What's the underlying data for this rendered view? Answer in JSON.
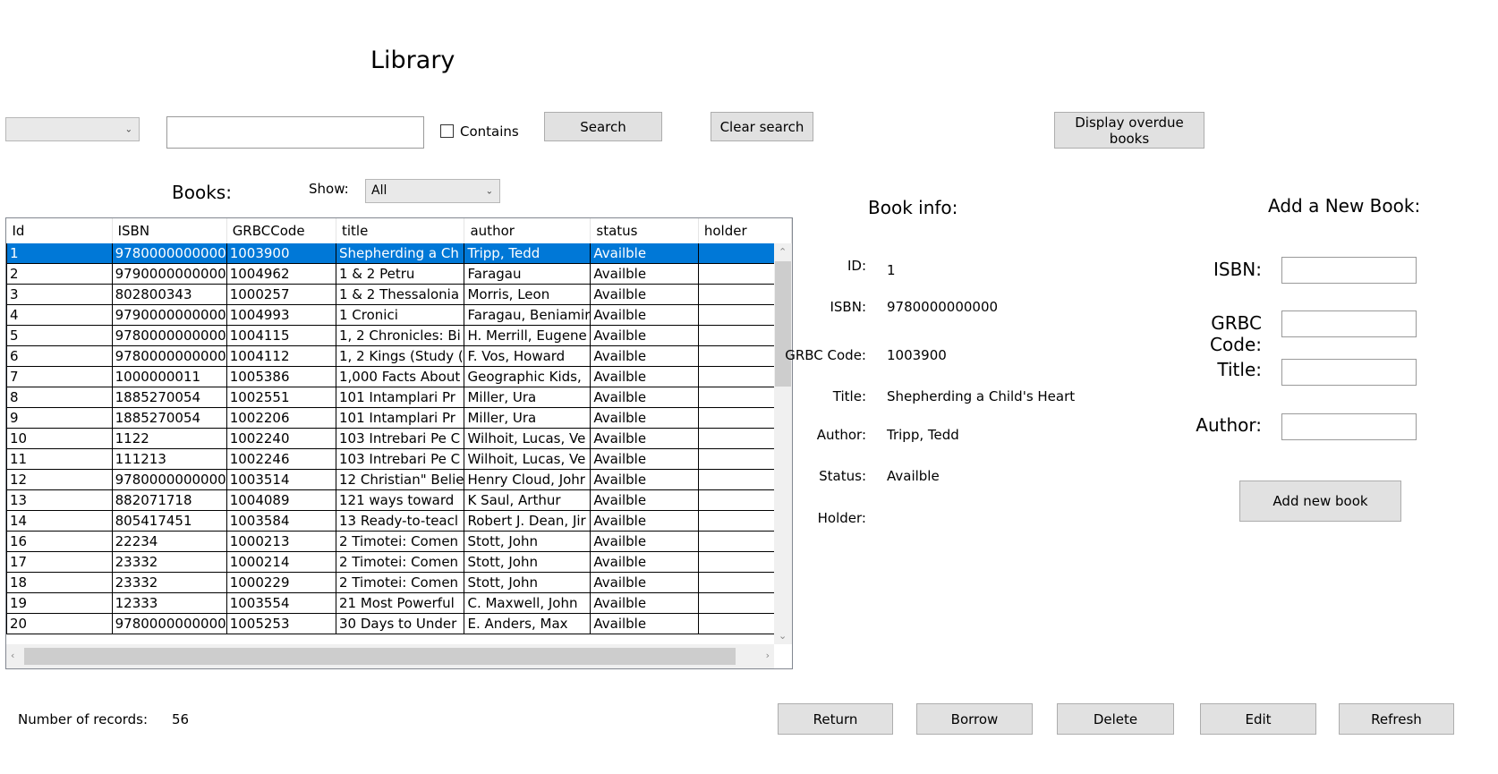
{
  "window": {
    "title": "Library"
  },
  "search": {
    "field_combo_value": "",
    "query_value": "",
    "contains_label": "Contains",
    "contains_checked": false,
    "search_button": "Search",
    "clear_button": "Clear search",
    "overdue_button": "Display overdue books"
  },
  "books": {
    "label": "Books:",
    "show_label": "Show:",
    "show_value": "All",
    "columns": [
      "Id",
      "ISBN",
      "GRBCCode",
      "title",
      "author",
      "status",
      "holder"
    ],
    "rows": [
      [
        "1",
        "9780000000000",
        "1003900",
        "Shepherding a Ch",
        "Tripp, Tedd",
        "Availble",
        ""
      ],
      [
        "2",
        "9790000000000",
        "1004962",
        "1 & 2 Petru",
        "Faragau",
        "Availble",
        ""
      ],
      [
        "3",
        "802800343",
        "1000257",
        "1 & 2 Thessalonia",
        "Morris, Leon",
        "Availble",
        ""
      ],
      [
        "4",
        "9790000000000",
        "1004993",
        "1 Cronici",
        "Faragau, Beniamir",
        "Availble",
        ""
      ],
      [
        "5",
        "9780000000000",
        "1004115",
        "1, 2 Chronicles: Bi",
        "H. Merrill, Eugene",
        "Availble",
        ""
      ],
      [
        "6",
        "9780000000000",
        "1004112",
        "1, 2 Kings (Study (",
        "F. Vos, Howard",
        "Availble",
        ""
      ],
      [
        "7",
        "1000000011",
        "1005386",
        "1,000 Facts About",
        "Geographic Kids,",
        "Availble",
        ""
      ],
      [
        "8",
        "1885270054",
        "1002551",
        "101 Intamplari Pr",
        "Miller, Ura",
        "Availble",
        ""
      ],
      [
        "9",
        "1885270054",
        "1002206",
        "101 Intamplari Pr",
        "Miller, Ura",
        "Availble",
        ""
      ],
      [
        "10",
        "1122",
        "1002240",
        "103 Intrebari Pe C",
        "Wilhoit, Lucas, Ve",
        "Availble",
        ""
      ],
      [
        "11",
        "111213",
        "1002246",
        "103 Intrebari Pe C",
        "Wilhoit, Lucas, Ve",
        "Availble",
        ""
      ],
      [
        "12",
        "9780000000000",
        "1003514",
        "12 Christian\" Belie",
        "Henry Cloud, Johr",
        "Availble",
        ""
      ],
      [
        "13",
        "882071718",
        "1004089",
        "121 ways toward",
        "K Saul, Arthur",
        "Availble",
        ""
      ],
      [
        "14",
        "805417451",
        "1003584",
        "13 Ready-to-teacl",
        "Robert J. Dean, Jir",
        "Availble",
        ""
      ],
      [
        "16",
        "22234",
        "1000213",
        "2 Timotei: Comen",
        "Stott, John",
        "Availble",
        ""
      ],
      [
        "17",
        "23332",
        "1000214",
        "2 Timotei: Comen",
        "Stott, John",
        "Availble",
        ""
      ],
      [
        "18",
        "23332",
        "1000229",
        "2 Timotei: Comen",
        "Stott, John",
        "Availble",
        ""
      ],
      [
        "19",
        "12333",
        "1003554",
        "21 Most Powerful",
        "C. Maxwell, John",
        "Availble",
        ""
      ],
      [
        "20",
        "9780000000000",
        "1005253",
        "30 Days to Under",
        "E. Anders, Max",
        "Availble",
        ""
      ]
    ],
    "selected_row": 0,
    "record_count_label": "Number of records:",
    "record_count": "56"
  },
  "book_info": {
    "heading": "Book info:",
    "id_label": "ID:",
    "id_value": "1",
    "isbn_label": "ISBN:",
    "isbn_value": "9780000000000",
    "grbc_label": "GRBC Code:",
    "grbc_value": "1003900",
    "title_label": "Title:",
    "title_value": "Shepherding a Child's Heart",
    "author_label": "Author:",
    "author_value": "Tripp, Tedd",
    "status_label": "Status:",
    "status_value": "Availble",
    "holder_label": "Holder:",
    "holder_value": ""
  },
  "new_book": {
    "heading": "Add a New Book:",
    "isbn_label": "ISBN:",
    "grbc_label": "GRBC Code:",
    "title_label": "Title:",
    "author_label": "Author:",
    "isbn_value": "",
    "grbc_value": "",
    "title_value": "",
    "author_value": "",
    "add_button": "Add new book"
  },
  "actions": {
    "return": "Return",
    "borrow": "Borrow",
    "delete": "Delete",
    "edit": "Edit",
    "refresh": "Refresh"
  },
  "colors": {
    "selection": "#0078d7",
    "button": "#e1e1e1"
  }
}
